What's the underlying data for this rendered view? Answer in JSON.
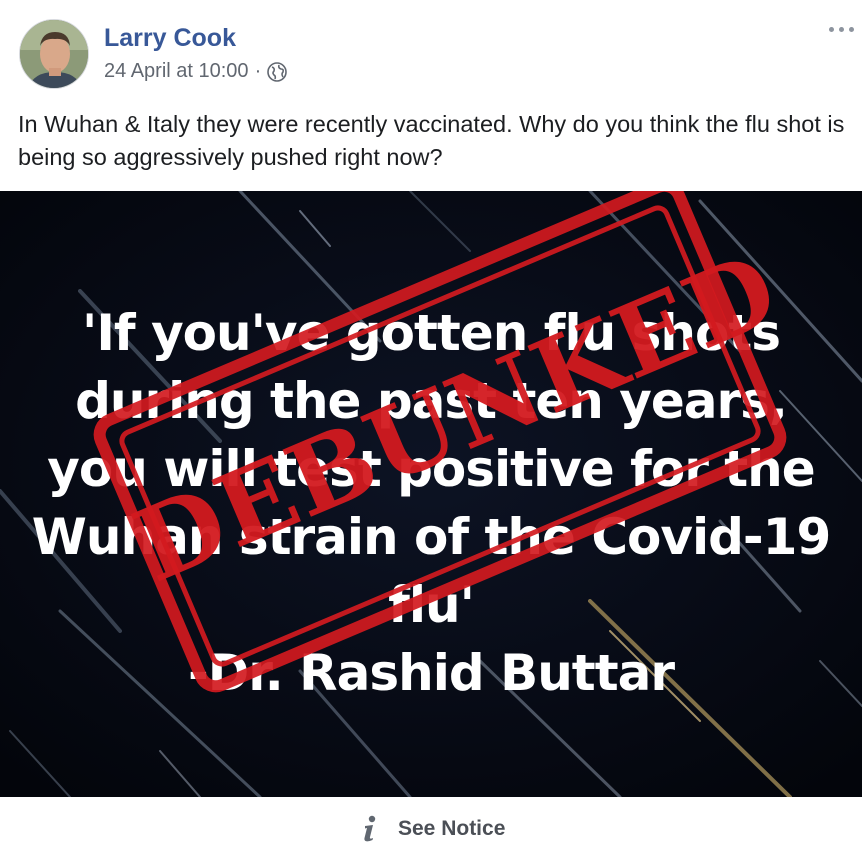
{
  "post": {
    "author": "Larry Cook",
    "timestamp": "24 April at 10:00",
    "separator": "·",
    "privacy_icon": "globe-icon",
    "more_icon": "more-options-icon",
    "text": "In Wuhan & Italy they were recently vaccinated. Why do you think the flu shot is being so aggressively pushed right now?"
  },
  "image": {
    "quote_lines": [
      "'If you've gotten flu shots",
      "during the past ten years,",
      "you will test positive for the",
      "Wuhan strain of the Covid-19",
      "flu'",
      "-Dr. Rashid Buttar"
    ],
    "stamp_text": "DEBUNKED",
    "stamp_color": "#d31a1f"
  },
  "footer": {
    "notice_icon": "info-icon",
    "notice_label": "See Notice"
  },
  "colors": {
    "author": "#385898",
    "meta": "#616770",
    "text": "#1c1e21",
    "image_bg": "#05070f"
  }
}
